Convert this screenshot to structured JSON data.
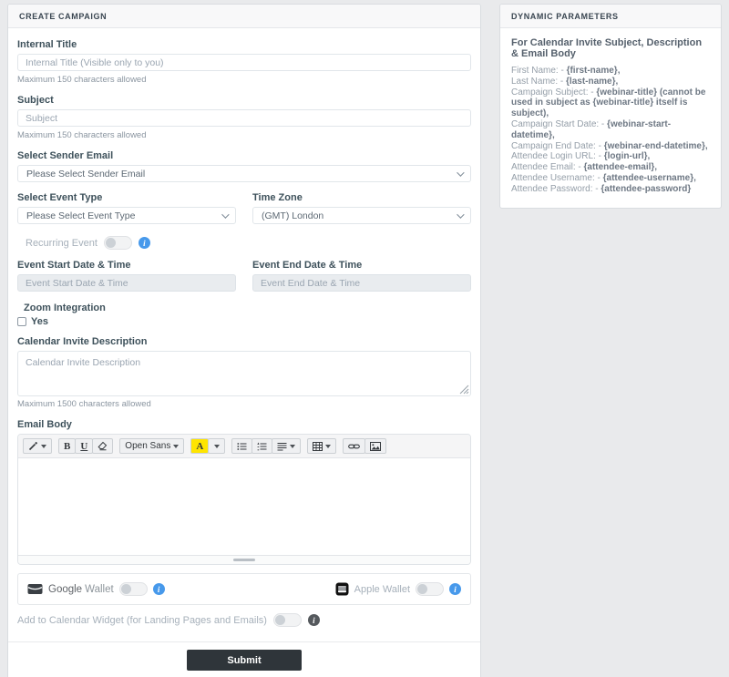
{
  "colors": {
    "accent_blue": "#4799eb",
    "submit_bg": "#2f353a",
    "highlight_yellow": "#ffe500"
  },
  "icons": {
    "chevron_down": "css-border-v",
    "info": "i",
    "caret_down": "css-triangle",
    "magic": "wand",
    "eraser": "eraser",
    "unordered_list": "bullets",
    "ordered_list": "numbers",
    "paragraph": "align-lines",
    "table": "grid",
    "link": "chain",
    "picture": "image",
    "resize_handle": "diagonal-grip",
    "drag_handle": "bar",
    "google_wallet": "dark-wallet",
    "apple_wallet": "black-wallet"
  },
  "left_panel": {
    "title": "CREATE CAMPAIGN",
    "internal_title": {
      "label": "Internal Title",
      "placeholder": "Internal Title (Visible only to you)",
      "helper": "Maximum 150 characters allowed"
    },
    "subject": {
      "label": "Subject",
      "placeholder": "Subject",
      "helper": "Maximum 150 characters allowed"
    },
    "sender_email": {
      "label": "Select Sender Email",
      "selected": "Please Select Sender Email"
    },
    "event_type": {
      "label": "Select Event Type",
      "selected": "Please Select Event Type"
    },
    "time_zone": {
      "label": "Time Zone",
      "selected": "(GMT) London"
    },
    "recurring_event": {
      "label": "Recurring Event",
      "state": "off"
    },
    "event_start": {
      "label": "Event Start Date & Time",
      "placeholder": "Event Start Date & Time"
    },
    "event_end": {
      "label": "Event End Date & Time",
      "placeholder": "Event End Date & Time"
    },
    "zoom_integration": {
      "label": "Zoom Integration",
      "option": "Yes",
      "checked": false
    },
    "calendar_description": {
      "label": "Calendar Invite Description",
      "placeholder": "Calendar Invite Description",
      "helper": "Maximum 1500 characters allowed"
    },
    "email_body": {
      "label": "Email Body",
      "toolbar": {
        "bold": "B",
        "underline": "U",
        "font_name": "Open Sans",
        "font_color": "A"
      }
    },
    "google_wallet": {
      "brand": "Google",
      "word": "Wallet",
      "state": "off"
    },
    "apple_wallet": {
      "label": "Apple Wallet",
      "state": "off"
    },
    "add_to_calendar": {
      "label": "Add to Calendar Widget (for Landing Pages and Emails)",
      "state": "off"
    },
    "submit_label": "Submit"
  },
  "right_panel": {
    "title": "DYNAMIC PARAMETERS",
    "intro": "For Calendar Invite Subject, Description & Email Body",
    "lines": [
      {
        "label": "First Name: - ",
        "token": "{first-name},"
      },
      {
        "label": "Last Name: - ",
        "token": "{last-name},"
      },
      {
        "label": "Campaign Subject: - ",
        "token": "{webinar-title} (cannot be used in subject as {webinar-title} itself is subject),"
      },
      {
        "label": "Campaign Start Date: - ",
        "token": "{webinar-start-datetime},"
      },
      {
        "label": "Campaign End Date: - ",
        "token": "{webinar-end-datetime},"
      },
      {
        "label": "Attendee Login URL: - ",
        "token": "{login-url},"
      },
      {
        "label": "Attendee Email: - ",
        "token": "{attendee-email},"
      },
      {
        "label": "Attendee Username: - ",
        "token": "{attendee-username},"
      },
      {
        "label": "Attendee Password: - ",
        "token": "{attendee-password}"
      }
    ]
  }
}
